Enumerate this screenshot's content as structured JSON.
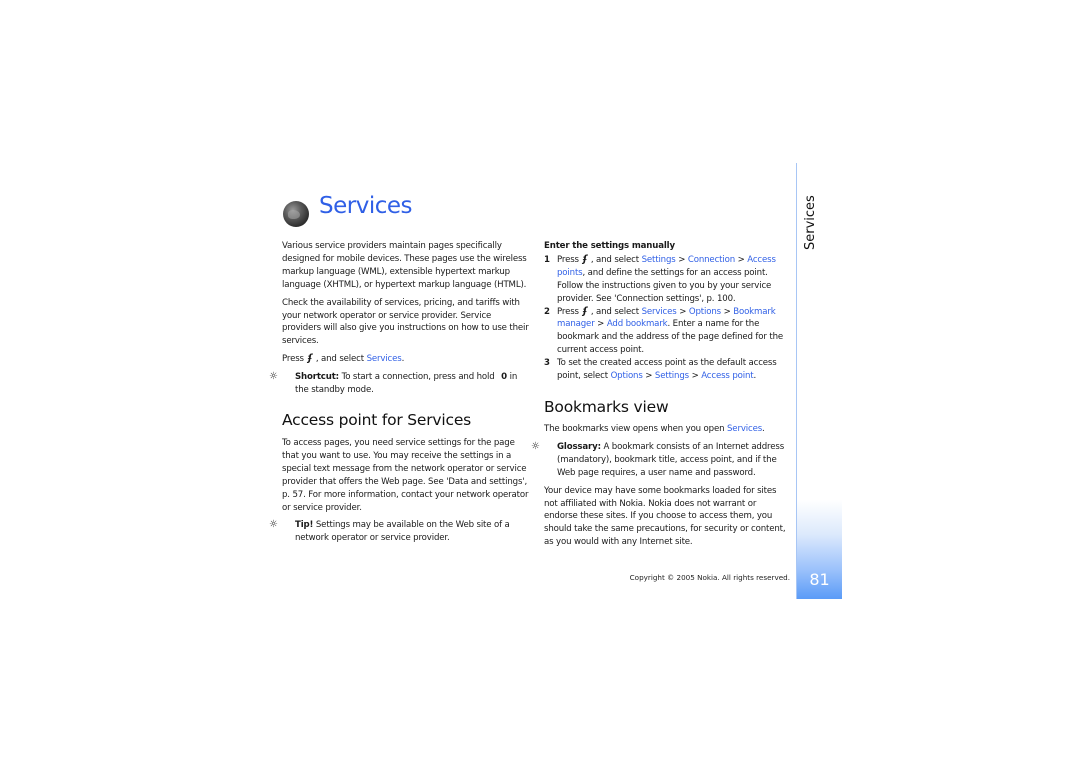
{
  "page": {
    "title": "Services",
    "section_tab": "Services",
    "page_number": "81",
    "copyright": "Copyright © 2005 Nokia. All rights reserved.",
    "accent_color": "#2f5fe6"
  },
  "left": {
    "intro_p1": "Various service providers maintain pages specifically designed for mobile devices. These pages use the wireless markup language (WML), extensible hypertext markup language (XHTML), or hypertext markup language (HTML).",
    "intro_p2": "Check the availability of services, pricing, and tariffs with your network operator or service provider. Service providers will also give you instructions on how to use their services.",
    "press_prefix": "Press",
    "press_mid": ", and select",
    "press_link": "Services",
    "press_end": ".",
    "shortcut_label": "Shortcut:",
    "shortcut_text": "To start a connection, press and hold",
    "shortcut_key": "0",
    "shortcut_tail": "in the standby mode.",
    "access_heading": "Access point for Services",
    "access_p1": "To access pages, you need service settings for the page that you want to use. You may receive the settings in a special text message from the network operator or service provider that offers the Web page. See 'Data and settings', p. 57. For more information, contact your network operator or service provider.",
    "tip_label": "Tip!",
    "tip_text": "Settings may be available on the Web site of a network operator or service provider."
  },
  "right": {
    "manual_heading": "Enter the settings manually",
    "steps": [
      {
        "num": "1",
        "press": "Press",
        "mid": ", and select",
        "links": [
          "Settings",
          "Connection",
          "Access points"
        ],
        "sep": ">",
        "text": ", and define the settings for an access point. Follow the instructions given to you by your service provider. See 'Connection settings', p. 100."
      },
      {
        "num": "2",
        "press": "Press",
        "mid": ", and select",
        "links": [
          "Services",
          "Options",
          "Bookmark manager",
          "Add bookmark"
        ],
        "sep": ">",
        "text": ". Enter a name for the bookmark and the address of the page defined for the current access point."
      },
      {
        "num": "3",
        "text_before": "To set the created access point as the default access point, select",
        "links": [
          "Options",
          "Settings",
          "Access point"
        ],
        "sep": ">",
        "end": "."
      }
    ],
    "bookmarks_heading": "Bookmarks view",
    "bookmarks_p1_text": "The bookmarks view opens when you open",
    "bookmarks_p1_link": "Services",
    "bookmarks_p1_end": ".",
    "glossary_label": "Glossary:",
    "glossary_text": "A bookmark consists of an Internet address (mandatory), bookmark title, access point, and if the Web page requires, a user name and password.",
    "bookmarks_p2": "Your device may have some bookmarks loaded for sites not affiliated with Nokia. Nokia does not warrant or endorse these sites. If you choose to access them, you should take the same precautions, for security or content, as you would with any Internet site."
  },
  "icons": {
    "menu_key": "ʄ",
    "tip": "☼"
  }
}
